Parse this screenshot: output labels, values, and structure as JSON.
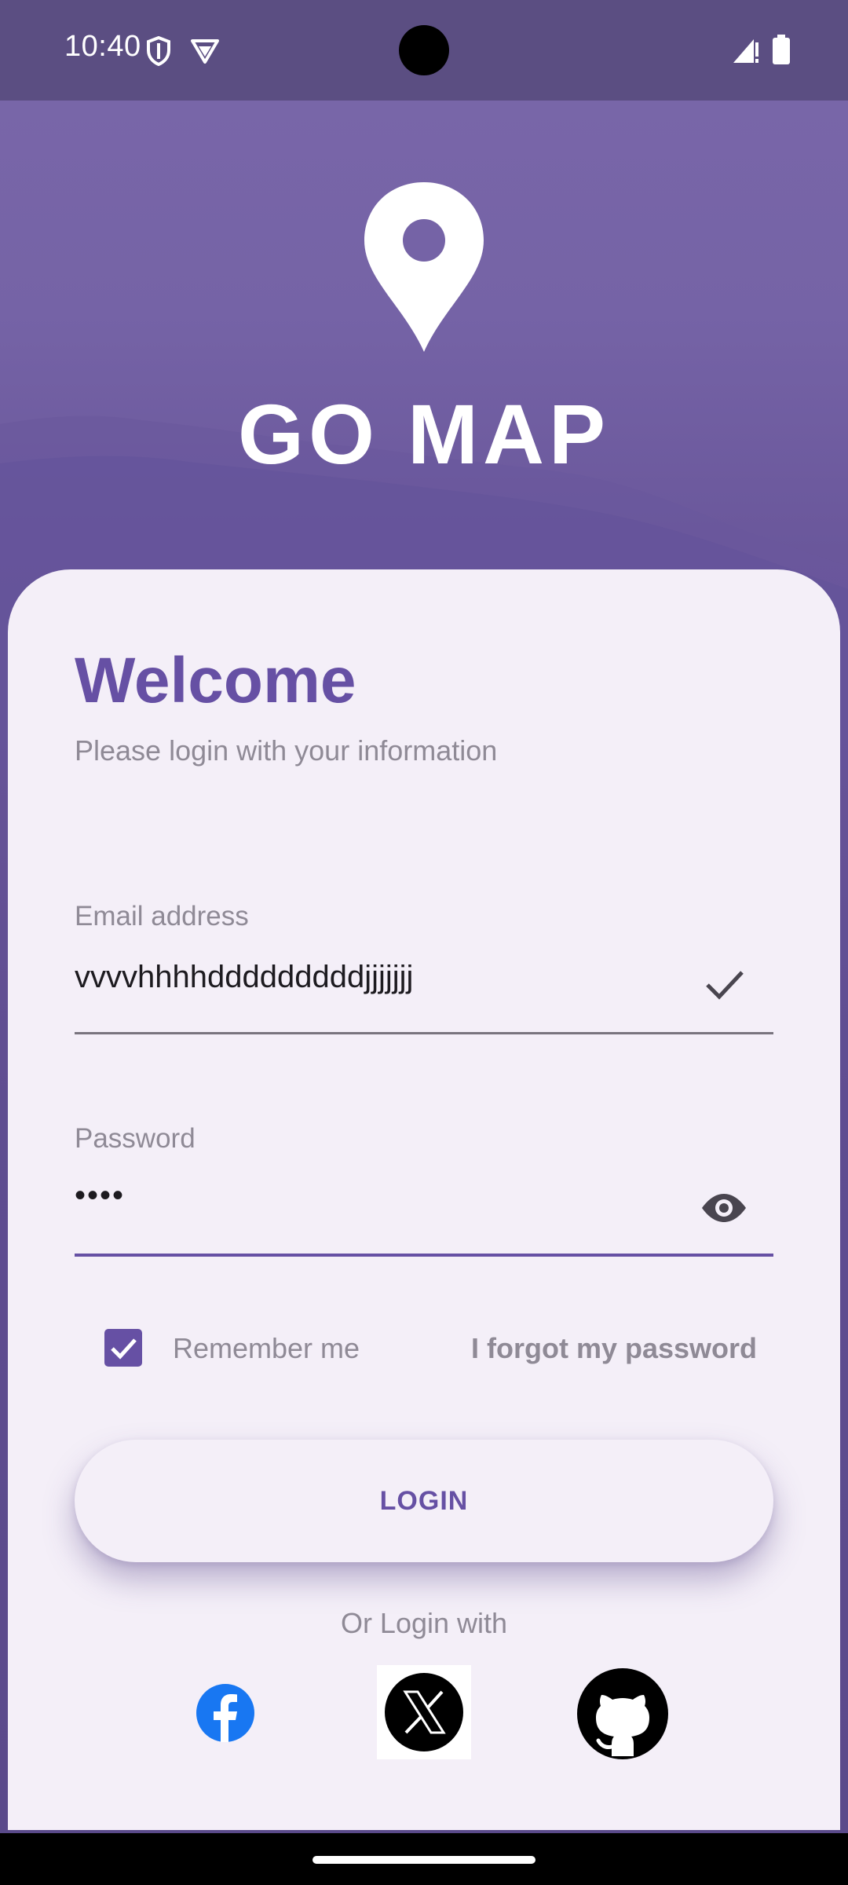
{
  "status_bar": {
    "time": "10:40",
    "icons": [
      "shield-icon",
      "vpn-icon",
      "signal-icon",
      "battery-icon"
    ]
  },
  "app": {
    "logo_icon": "map-pin-icon",
    "title": "GO MAP"
  },
  "login": {
    "welcome": "Welcome",
    "subtitle": "Please login with your information",
    "email": {
      "label": "Email address",
      "value": "vvvvhhhhdddddddddjjjjjjj",
      "status_icon": "check-icon"
    },
    "password": {
      "label": "Password",
      "value": "••••",
      "toggle_icon": "eye-icon"
    },
    "remember_me": {
      "label": "Remember me",
      "checked": true
    },
    "forgot_password": "I forgot my password",
    "login_button": "LOGIN",
    "or_login_with": "Or Login with",
    "social": [
      {
        "name": "facebook",
        "icon": "facebook-icon",
        "color": "#1877f2"
      },
      {
        "name": "x",
        "icon": "x-icon",
        "color": "#000000"
      },
      {
        "name": "github",
        "icon": "github-icon",
        "color": "#000000"
      }
    ]
  },
  "colors": {
    "primary": "#6650a4",
    "card_background": "#f4eff8",
    "hero_background": "#7563a6",
    "muted_text": "#8f8a96"
  }
}
